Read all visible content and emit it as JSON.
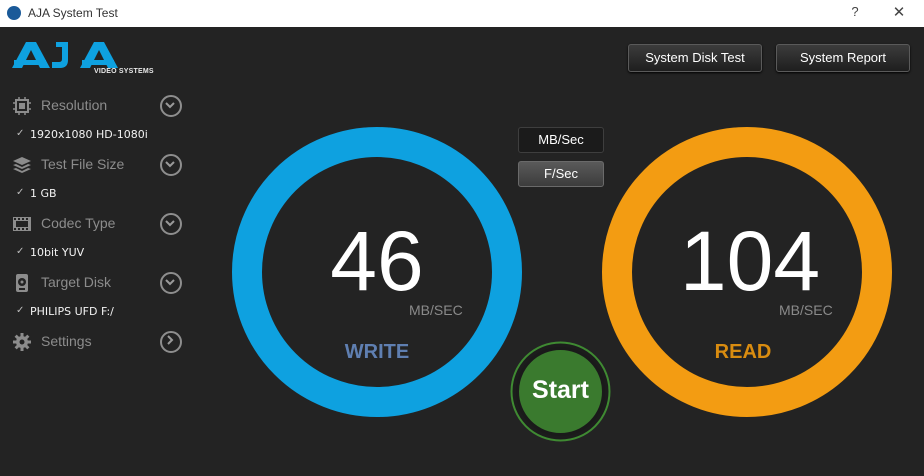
{
  "window": {
    "title": "AJA System Test",
    "help": "?",
    "close": "✕"
  },
  "logo": {
    "text": "AJA",
    "subtitle": "VIDEO SYSTEMS"
  },
  "sidebar": {
    "items": [
      {
        "label": "Resolution",
        "value": "1920x1080 HD-1080i",
        "icon": "chip-icon",
        "expanded": false
      },
      {
        "label": "Test File Size",
        "value": "1 GB",
        "icon": "stack-icon",
        "expanded": false
      },
      {
        "label": "Codec Type",
        "value": "10bit YUV",
        "icon": "film-icon",
        "expanded": false
      },
      {
        "label": "Target Disk",
        "value": "PHILIPS UFD F:/",
        "icon": "disk-icon",
        "expanded": false
      },
      {
        "label": "Settings",
        "value": "",
        "icon": "gear-icon",
        "expanded": false
      }
    ]
  },
  "toolbar": {
    "system_disk_test": "System Disk Test",
    "system_report": "System Report"
  },
  "units": {
    "mbsec": "MB/Sec",
    "fsec": "F/Sec",
    "selected": "F/Sec"
  },
  "write": {
    "value": "46",
    "unit": "MB/SEC",
    "label": "WRITE",
    "color": "#0ea1e0",
    "label_color": "#5f7fb1"
  },
  "read": {
    "value": "104",
    "unit": "MB/SEC",
    "label": "READ",
    "color": "#f39c12",
    "label_color": "#d98c10"
  },
  "start": {
    "label": "Start",
    "color": "#3a7a2e"
  },
  "colors": {
    "background": "#232323",
    "titlebar": "#ffffff"
  }
}
